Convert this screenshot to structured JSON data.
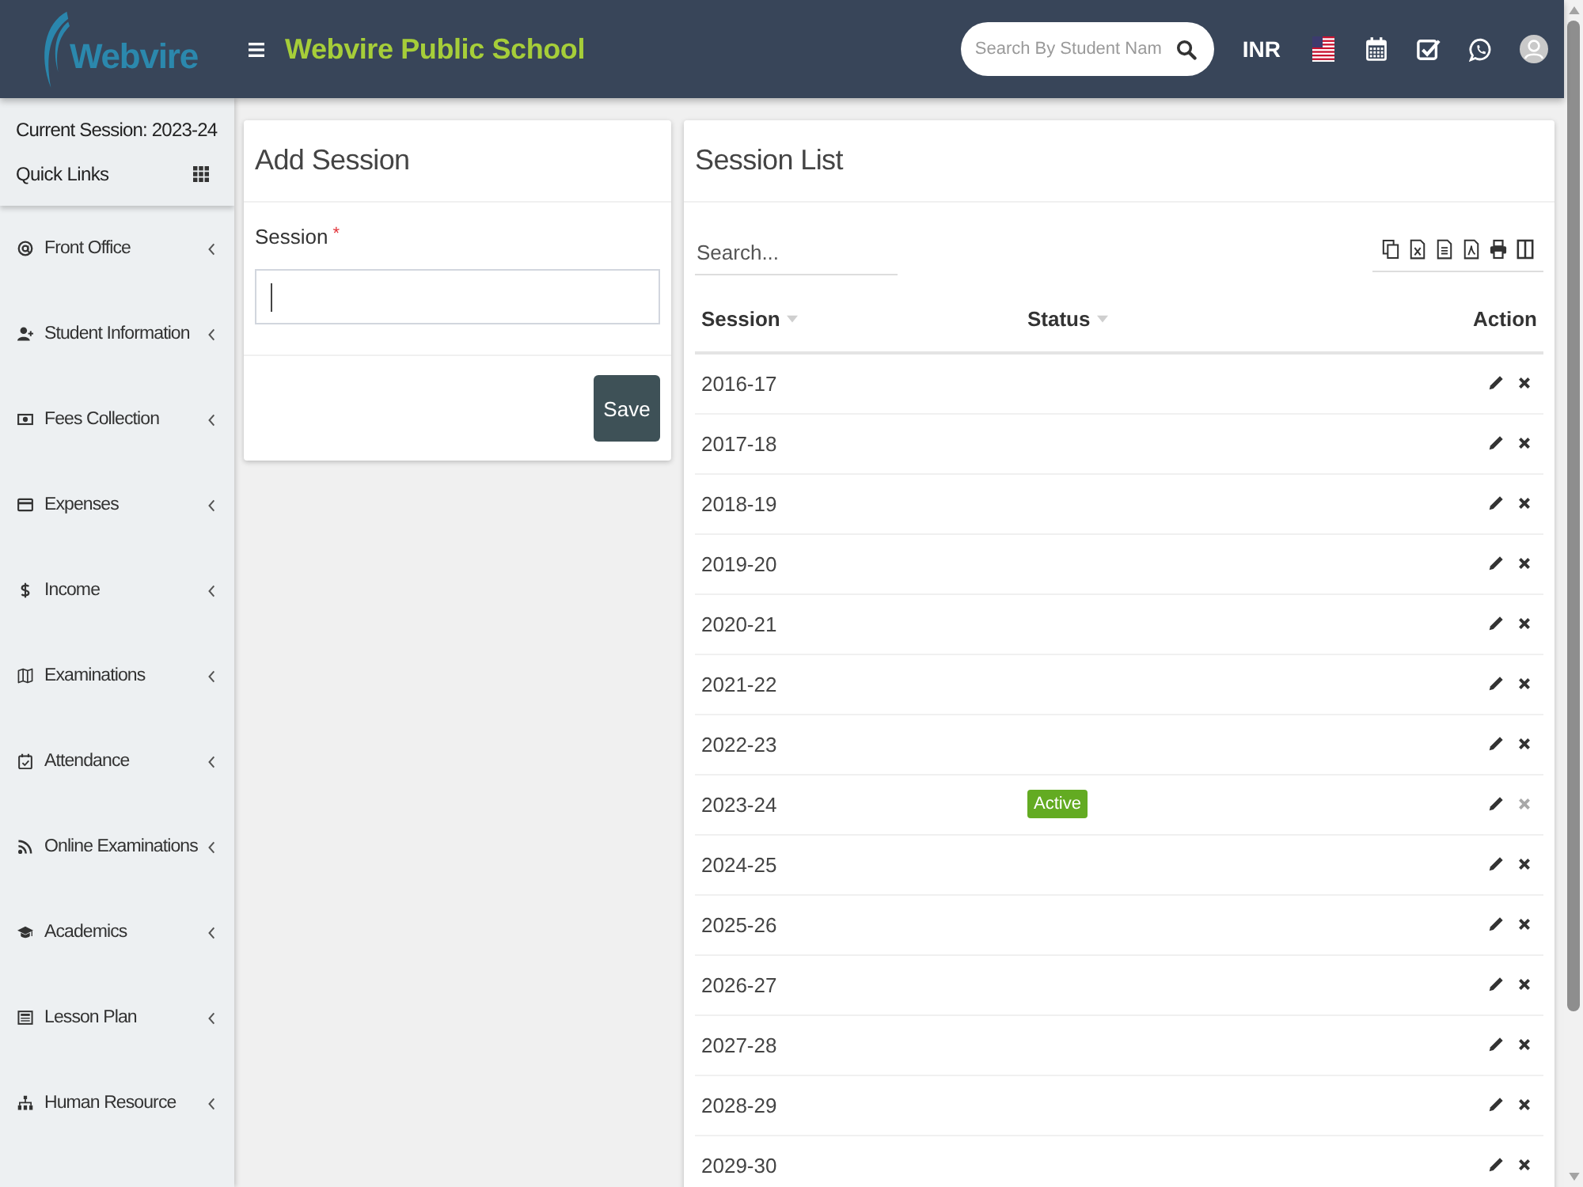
{
  "header": {
    "logo_text": "Webvire",
    "title": "Webvire Public School",
    "search": {
      "placeholder": "Search By Student Nam"
    },
    "currency": "INR"
  },
  "sidebar": {
    "session_label": "Current Session: 2023-24",
    "quick_links": "Quick Links",
    "items": [
      {
        "label": "Front Office",
        "expanded": false
      },
      {
        "label": "Student Information",
        "expanded": false
      },
      {
        "label": "Fees Collection",
        "expanded": false
      },
      {
        "label": "Expenses",
        "expanded": false
      },
      {
        "label": "Income",
        "expanded": false
      },
      {
        "label": "Examinations",
        "expanded": false
      },
      {
        "label": "Attendance",
        "expanded": false
      },
      {
        "label": "Online Examinations",
        "expanded": false
      },
      {
        "label": "Academics",
        "expanded": false
      },
      {
        "label": "Lesson Plan",
        "expanded": false
      },
      {
        "label": "Human Resource",
        "expanded": false
      }
    ]
  },
  "add_session": {
    "title": "Add Session",
    "field": {
      "label": "Session",
      "required_mark": "*",
      "focused": true
    },
    "save_button": "Save"
  },
  "session_list": {
    "title": "Session List",
    "search": {
      "placeholder": "Search..."
    },
    "columns": [
      {
        "label": "Session",
        "sortable": true
      },
      {
        "label": "Status",
        "sortable": true
      },
      {
        "label": "Action",
        "sortable": false
      }
    ],
    "rows": [
      {
        "session": "2016-17",
        "delete_disabled": false
      },
      {
        "session": "2017-18",
        "delete_disabled": false
      },
      {
        "session": "2018-19",
        "delete_disabled": false
      },
      {
        "session": "2019-20",
        "delete_disabled": false
      },
      {
        "session": "2020-21",
        "delete_disabled": false
      },
      {
        "session": "2021-22",
        "delete_disabled": false
      },
      {
        "session": "2022-23",
        "delete_disabled": false
      },
      {
        "session": "2023-24",
        "status": "Active",
        "delete_disabled": true
      },
      {
        "session": "2024-25",
        "delete_disabled": false
      },
      {
        "session": "2025-26",
        "delete_disabled": false
      },
      {
        "session": "2026-27",
        "delete_disabled": false
      },
      {
        "session": "2027-28",
        "delete_disabled": false
      },
      {
        "session": "2028-29",
        "delete_disabled": false
      },
      {
        "session": "2029-30",
        "delete_disabled": false
      }
    ]
  }
}
